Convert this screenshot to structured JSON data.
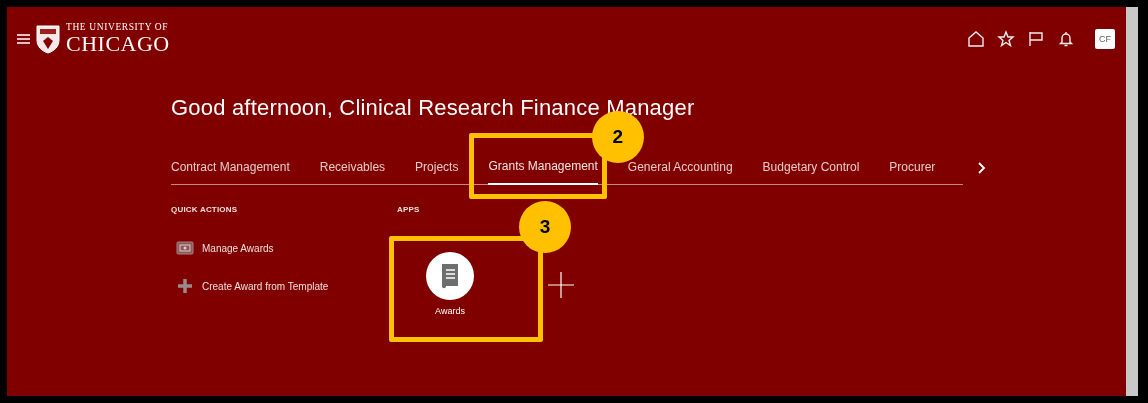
{
  "header": {
    "logo_line_1": "THE UNIVERSITY OF",
    "logo_line_2": "CHICAGO",
    "avatar": "CF"
  },
  "greeting": "Good afternoon, Clinical Research Finance Manager",
  "tabs": [
    {
      "label": "Contract Management",
      "selected": false
    },
    {
      "label": "Receivables",
      "selected": false
    },
    {
      "label": "Projects",
      "selected": false
    },
    {
      "label": "Grants Management",
      "selected": true,
      "callout": "2"
    },
    {
      "label": "General Accounting",
      "selected": false
    },
    {
      "label": "Budgetary Control",
      "selected": false
    },
    {
      "label": "Procurer",
      "selected": false
    }
  ],
  "quick_actions": {
    "title": "QUICK ACTIONS",
    "items": [
      {
        "kind": "manage",
        "label": "Manage Awards"
      },
      {
        "kind": "create",
        "label": "Create Award from Template"
      }
    ]
  },
  "apps": {
    "title": "APPS",
    "items": [
      {
        "label": "Awards",
        "callout": "3"
      }
    ]
  }
}
